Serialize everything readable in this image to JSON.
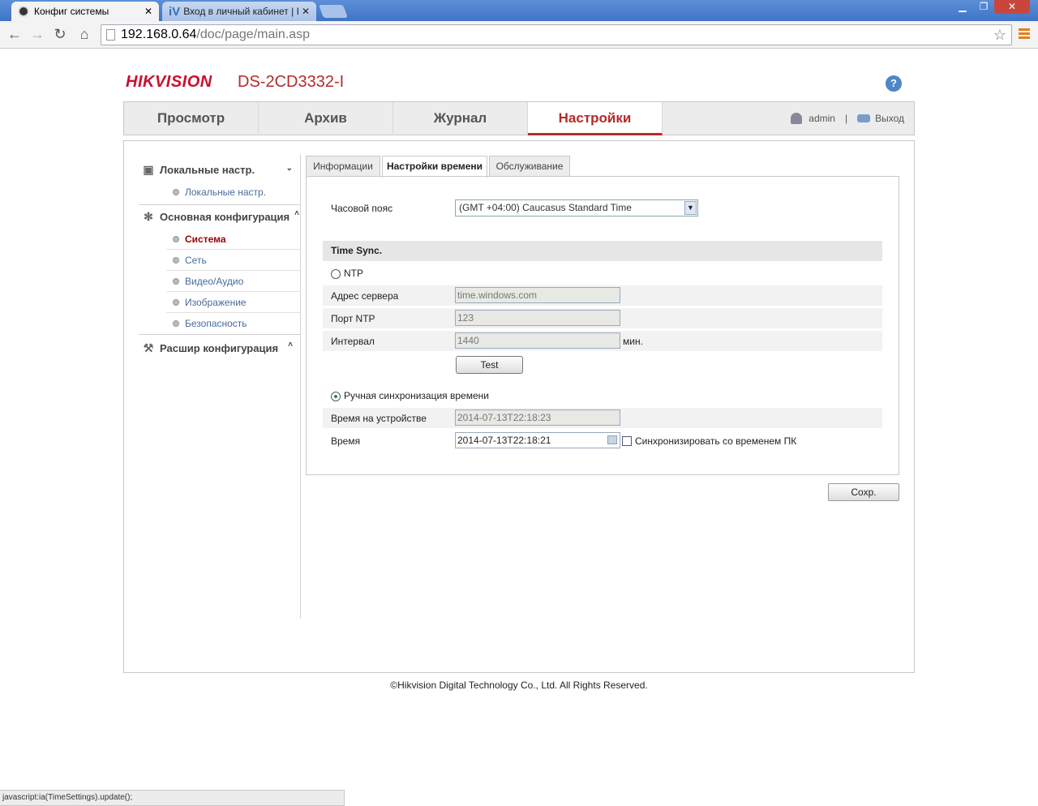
{
  "browser": {
    "tabs": [
      {
        "title": "Конфиг системы",
        "close": "✕"
      },
      {
        "title": "Вход в личный кабинет | Iv",
        "close": "✕",
        "favicon": "iV"
      }
    ],
    "url_host": "192.168.0.64",
    "url_path": "/doc/page/main.asp",
    "status": "javascript:ia(TimeSettings).update();"
  },
  "header": {
    "logo": "HIKVISION",
    "model": "DS-2CD3332-I",
    "help": "?"
  },
  "mainnav": {
    "tabs": [
      "Просмотр",
      "Архив",
      "Журнал",
      "Настройки"
    ],
    "user": "admin",
    "separator": "|",
    "logout": "Выход"
  },
  "sidebar": {
    "local_group": "Локальные настр.",
    "local_items": [
      "Локальные настр."
    ],
    "basic_group": "Основная конфигурация",
    "basic_items": [
      "Система",
      "Сеть",
      "Видео/Аудио",
      "Изображение",
      "Безопасность"
    ],
    "advanced_group": "Расшир конфигурация"
  },
  "subtabs": [
    "Информации",
    "Настройки времени",
    "Обслуживание"
  ],
  "form": {
    "timezone_label": "Часовой пояс",
    "timezone_value": "(GMT +04:00) Caucasus Standard Time",
    "timesync_header": "Time Sync.",
    "ntp_label": "NTP",
    "server_label": "Адрес сервера",
    "server_value": "time.windows.com",
    "port_label": "Порт NTP",
    "port_value": "123",
    "interval_label": "Интервал",
    "interval_value": "1440",
    "interval_unit": "мин.",
    "test_button": "Test",
    "manual_label": "Ручная синхронизация времени",
    "device_time_label": "Время на устройстве",
    "device_time_value": "2014-07-13T22:18:23",
    "time_label": "Время",
    "time_value": "2014-07-13T22:18:21",
    "sync_pc_label": "Синхронизировать со временем ПК"
  },
  "save_button": "Сохр.",
  "footer": "©Hikvision Digital Technology Co., Ltd. All Rights Reserved."
}
